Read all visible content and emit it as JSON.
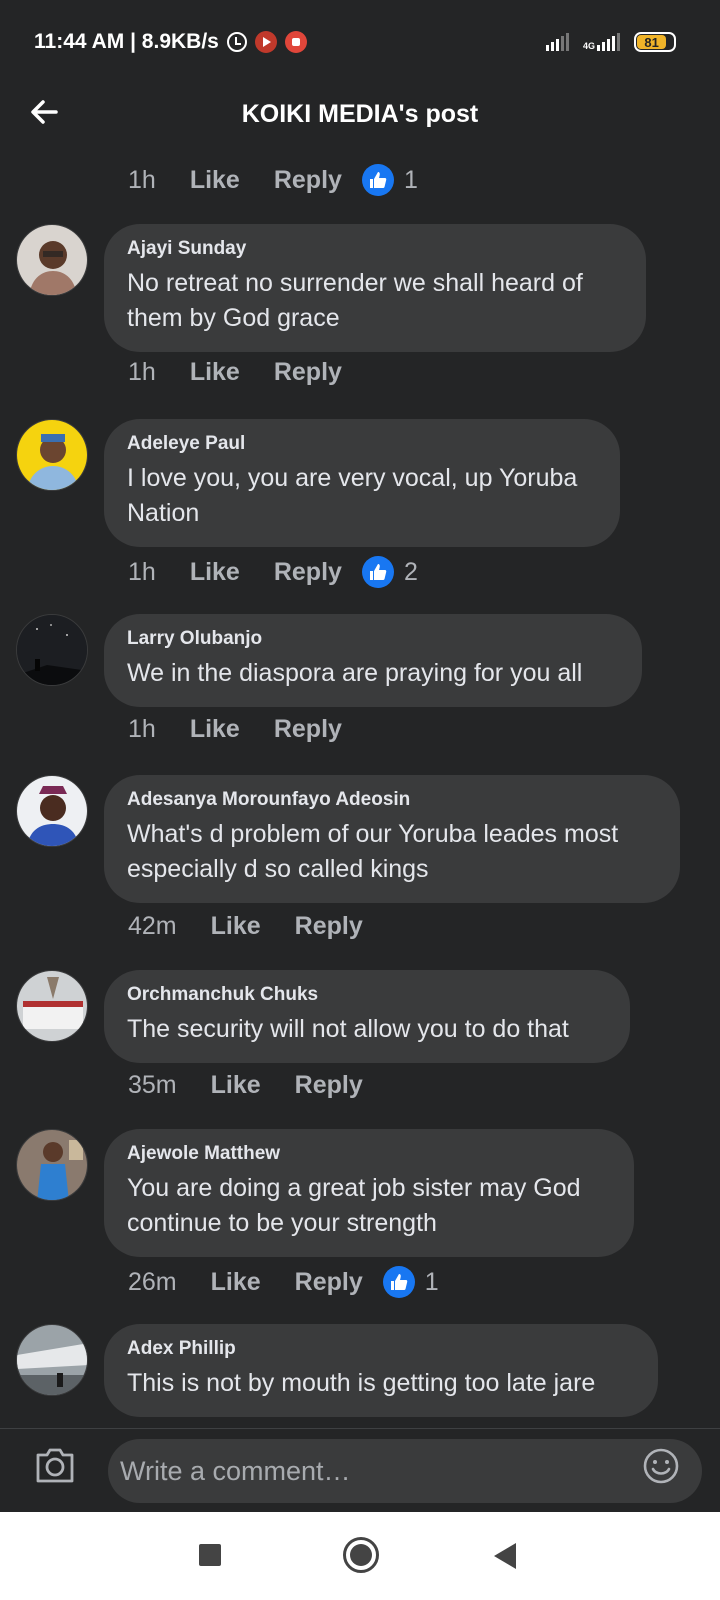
{
  "status_bar": {
    "time": "11:44 AM | 8.9KB/s",
    "network": "4G",
    "battery": "81"
  },
  "header": {
    "title": "KOIKI MEDIA's post"
  },
  "top_actions": {
    "time": "1h",
    "like": "Like",
    "reply": "Reply",
    "reaction_count": "1"
  },
  "comments": [
    {
      "author": "Ajayi Sunday",
      "text": "No retreat no surrender we shall  heard of them by God grace",
      "time": "1h",
      "like": "Like",
      "reply": "Reply",
      "reaction_count": ""
    },
    {
      "author": "Adeleye Paul",
      "text": "I love you, you are very vocal, up Yoruba Nation",
      "time": "1h",
      "like": "Like",
      "reply": "Reply",
      "reaction_count": "2"
    },
    {
      "author": "Larry Olubanjo",
      "text": "We in the diaspora are praying for you all",
      "time": "1h",
      "like": "Like",
      "reply": "Reply",
      "reaction_count": ""
    },
    {
      "author": "Adesanya Morounfayo Adeosin",
      "text": "What's d problem of our Yoruba leades most especially d so called kings",
      "time": "42m",
      "like": "Like",
      "reply": "Reply",
      "reaction_count": ""
    },
    {
      "author": "Orchmanchuk Chuks",
      "text": "The security will not allow you to do that",
      "time": "35m",
      "like": "Like",
      "reply": "Reply",
      "reaction_count": ""
    },
    {
      "author": "Ajewole Matthew",
      "text": "You are doing a great job sister may God continue to be your strength",
      "time": "26m",
      "like": "Like",
      "reply": "Reply",
      "reaction_count": "1"
    },
    {
      "author": "Adex Phillip",
      "text": "This is not by mouth is getting too late jare",
      "time": "",
      "like": "",
      "reply": "",
      "reaction_count": ""
    }
  ],
  "composer": {
    "placeholder": "Write a comment…"
  },
  "colors": {
    "background": "#242526",
    "bubble": "#3a3b3c",
    "like_blue": "#1877f2",
    "battery": "#f0b429"
  },
  "icons": {
    "back": "arrow-left-icon",
    "like": "thumbs-up-icon",
    "camera": "camera-icon",
    "emoji": "smiley-icon"
  }
}
